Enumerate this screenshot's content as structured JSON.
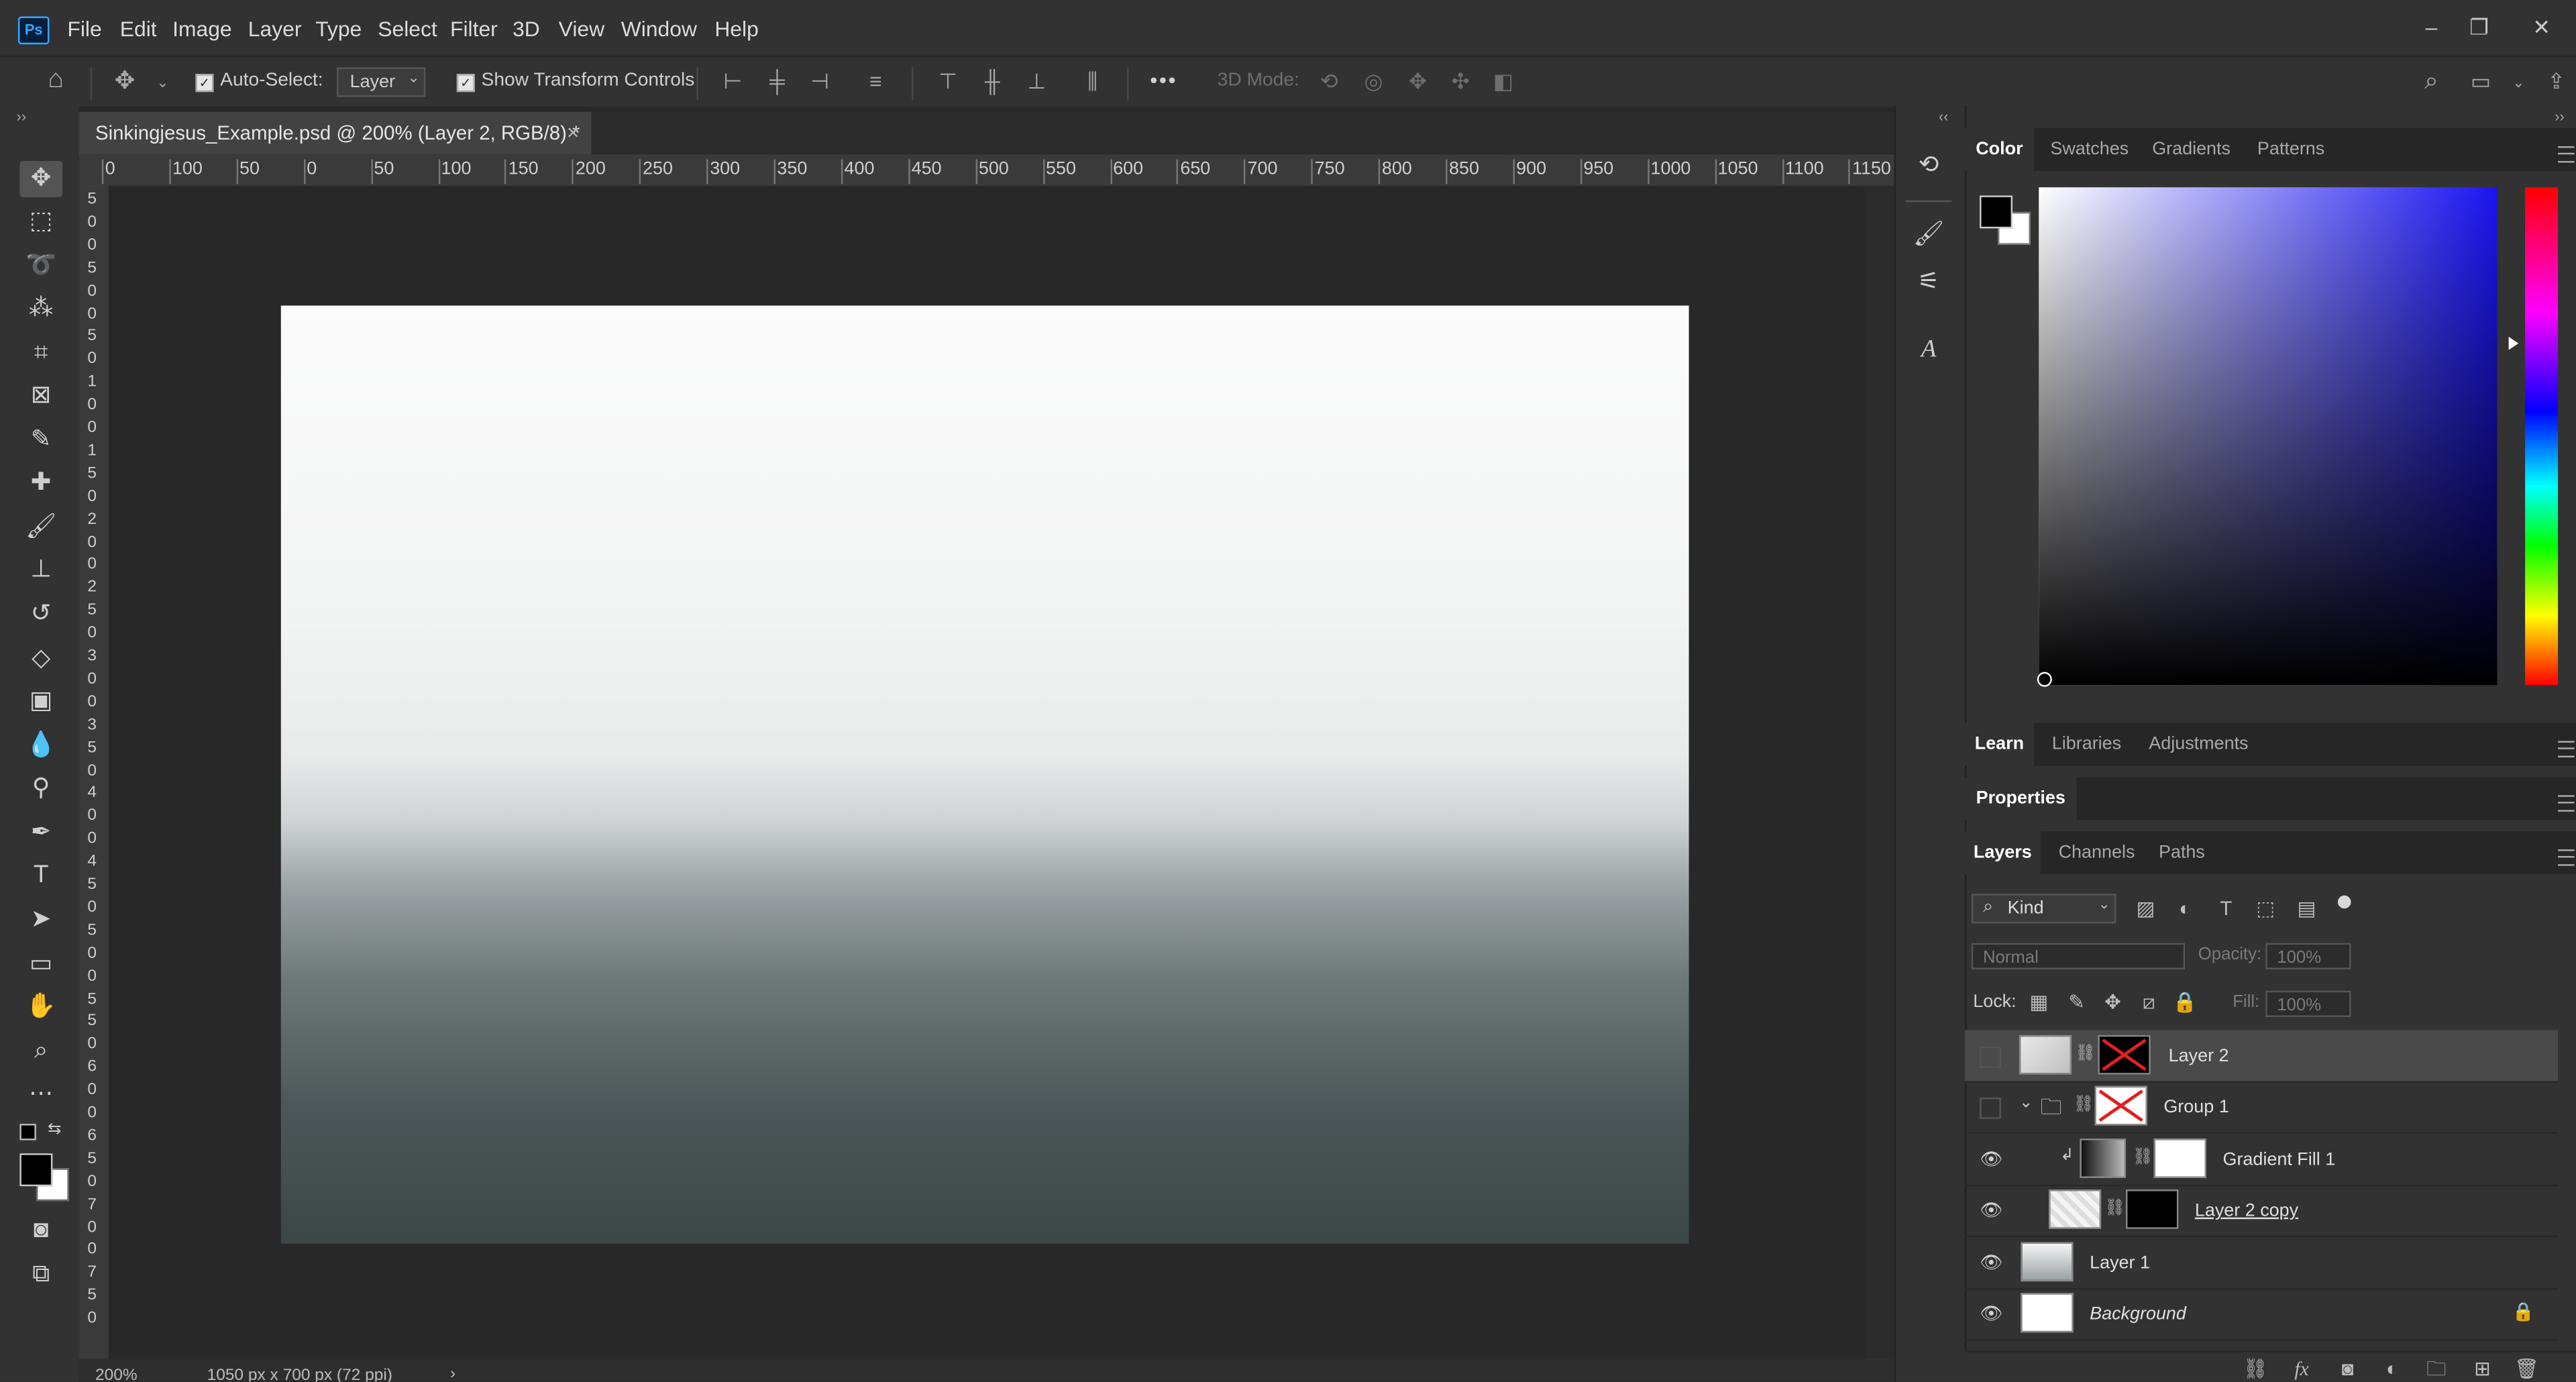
{
  "app": {
    "logo_text": "Ps"
  },
  "menu": [
    "File",
    "Edit",
    "Image",
    "Layer",
    "Type",
    "Select",
    "Filter",
    "3D",
    "View",
    "Window",
    "Help"
  ],
  "window_controls": {
    "minimize": "–",
    "restore": "❐",
    "close": "✕"
  },
  "options_bar": {
    "auto_select_label": "Auto-Select:",
    "auto_select_value": "Layer",
    "show_transform_label": "Show Transform Controls",
    "more": "•••",
    "mode_3d_label": "3D Mode:"
  },
  "document": {
    "tab_title": "Sinkingjesus_Example.psd @ 200% (Layer 2, RGB/8) *",
    "close": "×",
    "zoom": "200%",
    "doc_info": "1050 px x 700 px (72 ppi)",
    "info_arrow": "›"
  },
  "ruler": {
    "top": [
      "0",
      "100",
      "50",
      "0",
      "50",
      "100",
      "150",
      "200",
      "250",
      "300",
      "350",
      "400",
      "450",
      "500",
      "550",
      "600",
      "650",
      "700",
      "750",
      "800",
      "850",
      "900",
      "950",
      "1000",
      "1050",
      "1100",
      "1150"
    ],
    "left": [
      "5",
      "0",
      "0",
      "5",
      "0",
      "0",
      "5",
      "0",
      "1",
      "0",
      "0",
      "1",
      "5",
      "0",
      "2",
      "0",
      "0",
      "2",
      "5",
      "0",
      "3",
      "0",
      "0",
      "3",
      "5",
      "0",
      "4",
      "0",
      "0",
      "4",
      "5",
      "0",
      "5",
      "0",
      "0",
      "5",
      "5",
      "0",
      "6",
      "0",
      "0",
      "6",
      "5",
      "0",
      "7",
      "0",
      "0",
      "7",
      "5",
      "0"
    ]
  },
  "color_panel": {
    "tabs": [
      "Color",
      "Swatches",
      "Gradients",
      "Patterns"
    ],
    "active": "Color",
    "fg": "#000000",
    "bg": "#ffffff",
    "field_hue": "#1a14f0"
  },
  "learn_panel": {
    "tabs": [
      "Learn",
      "Libraries",
      "Adjustments"
    ]
  },
  "properties_panel": {
    "title": "Properties"
  },
  "layers_panel": {
    "tabs": [
      "Layers",
      "Channels",
      "Paths"
    ],
    "kind_label": "Kind",
    "blend_mode": "Normal",
    "opacity_label": "Opacity:",
    "opacity_value": "100%",
    "lock_label": "Lock:",
    "fill_label": "Fill:",
    "fill_value": "100%",
    "layers": [
      {
        "name": "Layer 2",
        "visible": false,
        "selected": true
      },
      {
        "name": "Group 1",
        "visible": false,
        "selected": false
      },
      {
        "name": "Gradient Fill 1",
        "visible": true,
        "selected": false
      },
      {
        "name": "Layer 2 copy",
        "visible": true,
        "selected": false
      },
      {
        "name": "Layer 1",
        "visible": true,
        "selected": false
      },
      {
        "name": "Background",
        "visible": true,
        "selected": false
      }
    ],
    "footer_icons": [
      "link-icon",
      "fx-icon",
      "mask-icon",
      "adjustment-icon",
      "folder-icon",
      "new-layer-icon",
      "trash-icon"
    ],
    "fx_text": "fx"
  },
  "collapse_left": "‹‹",
  "collapse_right": "››",
  "toolbar_expand": "››"
}
